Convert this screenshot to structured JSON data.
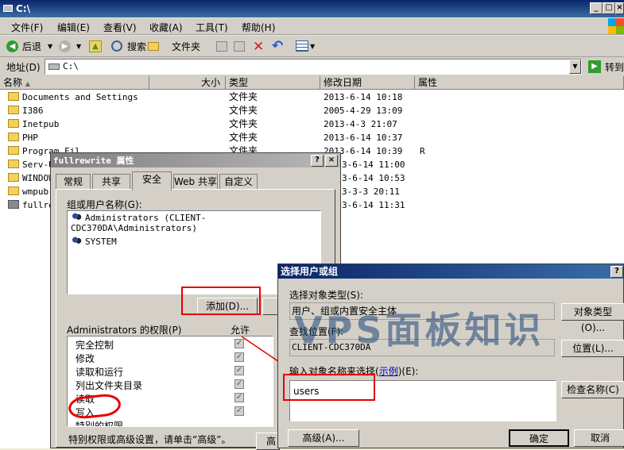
{
  "window": {
    "title": "C:\\"
  },
  "menu": [
    "文件(F)",
    "编辑(E)",
    "查看(V)",
    "收藏(A)",
    "工具(T)",
    "帮助(H)"
  ],
  "toolbar": {
    "back": "后退",
    "search": "搜索",
    "folders": "文件夹"
  },
  "address": {
    "label": "地址(D)",
    "value": "C:\\",
    "go": "转到"
  },
  "columns": {
    "name": "名称",
    "size": "大小",
    "type": "类型",
    "modified": "修改日期",
    "attr": "属性"
  },
  "files": [
    {
      "name": "Documents and Settings",
      "type": "文件夹",
      "date": "2013-6-14 10:18",
      "attr": ""
    },
    {
      "name": "I386",
      "type": "文件夹",
      "date": "2005-4-29 13:09",
      "attr": ""
    },
    {
      "name": "Inetpub",
      "type": "文件夹",
      "date": "2013-4-3 21:07",
      "attr": ""
    },
    {
      "name": "PHP",
      "type": "文件夹",
      "date": "2013-6-14 10:37",
      "attr": ""
    },
    {
      "name": "Program Fil",
      "type": "文件夹",
      "date": "2013-6-14 10:39",
      "attr": "R"
    },
    {
      "name": "Serv-U",
      "type": "",
      "date": "3-6-14 11:00",
      "attr": ""
    },
    {
      "name": "WINDOW",
      "type": "",
      "date": "3-6-14 10:53",
      "attr": ""
    },
    {
      "name": "wmpub",
      "type": "",
      "date": "3-3-3 20:11",
      "attr": ""
    },
    {
      "name": "fullre",
      "type": "",
      "date": "3-6-14 11:31",
      "attr": ""
    }
  ],
  "props": {
    "title": "fullrewrite 属性",
    "tabs": [
      "常规",
      "共享",
      "安全",
      "Web 共享",
      "自定义"
    ],
    "group_label": "组或用户名称(G):",
    "users": [
      "Administrators (CLIENT-CDC370DA\\Administrators)",
      "SYSTEM"
    ],
    "add_button": "添加(D)...",
    "perm_label": "Administrators 的权限(P)",
    "allow": "允许",
    "perms": [
      "完全控制",
      "修改",
      "读取和运行",
      "列出文件夹目录",
      "读取",
      "写入",
      "特别的权限"
    ],
    "footer": "特别权限或高级设置，请单击“高级”。",
    "advanced_partial": "高"
  },
  "select": {
    "title": "选择用户或组",
    "type_label": "选择对象类型(S):",
    "type_value": "用户、组或内置安全主体",
    "type_button": "对象类型(O)...",
    "loc_label": "查找位置(F):",
    "loc_value": "CLIENT-CDC370DA",
    "loc_button": "位置(L)...",
    "enter_label": "输入对象名称来选择",
    "example": "示例",
    "enter_suffix": "(E):",
    "input_value": "users",
    "check_button": "检查名称(C)",
    "advanced_button": "高级(A)...",
    "ok": "确定",
    "cancel": "取消"
  },
  "watermark": "VPS面板知识"
}
